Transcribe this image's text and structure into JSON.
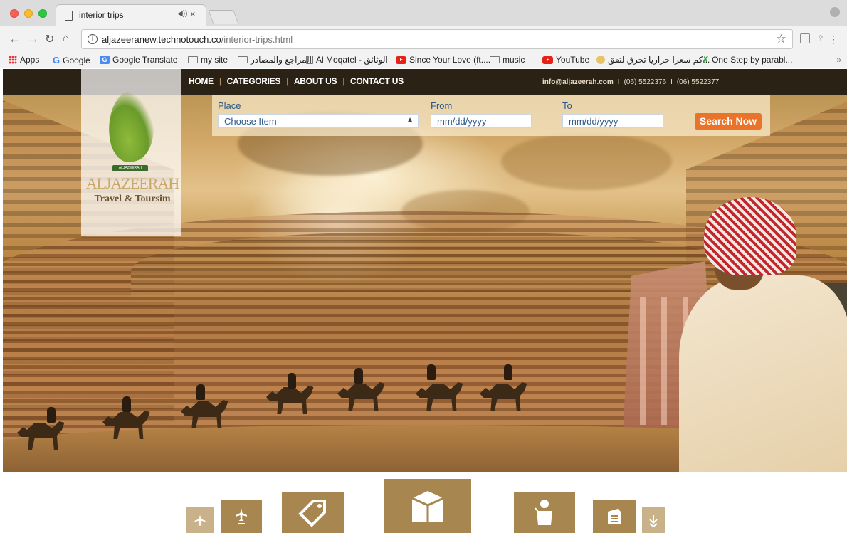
{
  "browser": {
    "tab_title": "interior trips",
    "url_host": "aljazeeranew.technotouch.co",
    "url_path": "/interior-trips.html",
    "bookmarks": [
      {
        "label": "Apps",
        "icon": "apps-grid-icon"
      },
      {
        "label": "Google",
        "icon": "google-icon"
      },
      {
        "label": "Google Translate",
        "icon": "google-translate-icon"
      },
      {
        "label": "my site",
        "icon": "folder-icon"
      },
      {
        "label": "المراجع والمصادر",
        "icon": "folder-icon"
      },
      {
        "label": "Al Moqatel - الوثائق",
        "icon": "page-icon"
      },
      {
        "label": "Since Your Love (ft....",
        "icon": "youtube-icon"
      },
      {
        "label": "music",
        "icon": "folder-icon"
      },
      {
        "label": "YouTube",
        "icon": "youtube-icon"
      },
      {
        "label": "كم سعرا حراريا تحرق لتفق...",
        "icon": "site-icon"
      },
      {
        "label": "One Step by parabl...",
        "icon": "site-icon"
      }
    ],
    "bookmarks_overflow": "»"
  },
  "site": {
    "logo": {
      "name": "ALJAZEERAH",
      "tagline": "Travel & Toursim",
      "badge": "ALJAZEERAH"
    },
    "nav": [
      "HOME",
      "CATEGORIES",
      "ABOUT US",
      "CONTACT US"
    ],
    "contact": {
      "email": "info@aljazeerah.com",
      "phone1": "(06) 5522376",
      "phone2": "(06) 5522377"
    },
    "search": {
      "place_label": "Place",
      "place_value": "Choose Item",
      "from_label": "From",
      "from_placeholder": "mm/dd/yyyy",
      "to_label": "To",
      "to_placeholder": "mm/dd/yyyy",
      "button": "Search Now"
    },
    "categories": [
      "plane-icon",
      "flight-badge-icon",
      "tag-icon",
      "kaaba-icon",
      "tour-guide-icon",
      "document-icon",
      "arrow-down-icon"
    ]
  },
  "colors": {
    "accent": "#e9732b",
    "brand_brown": "#a7864f",
    "link_blue": "#2b5a8a"
  }
}
